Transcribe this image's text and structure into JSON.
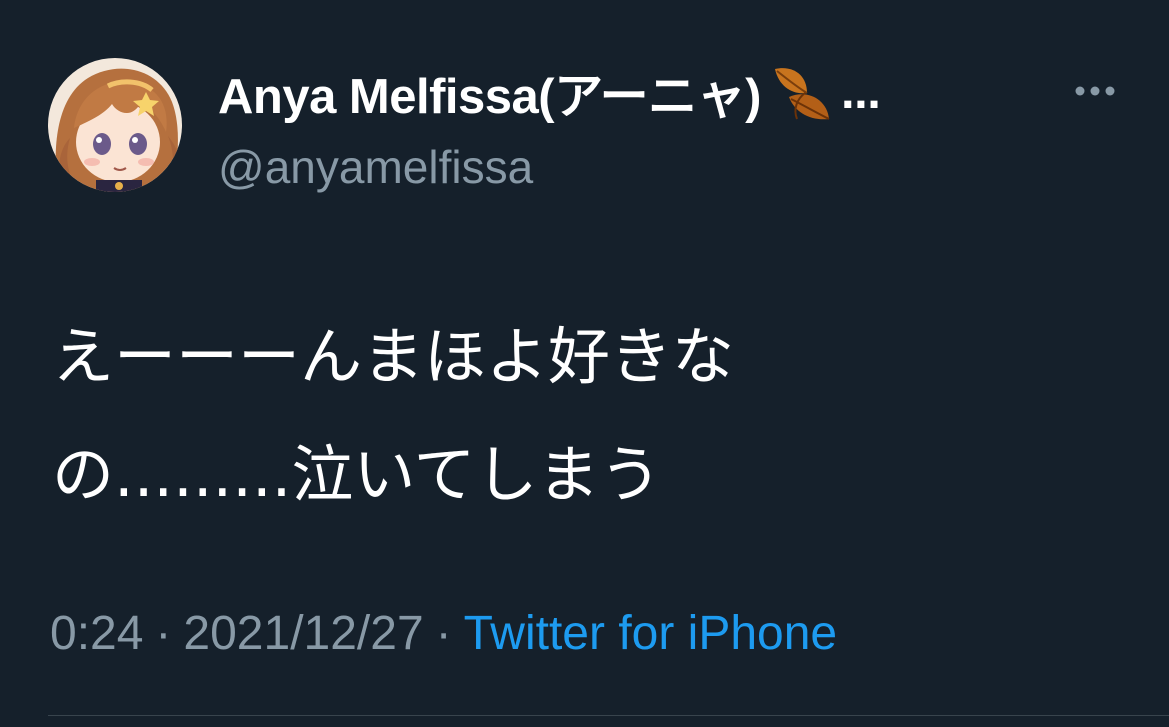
{
  "tweet": {
    "author": {
      "display_name": "Anya Melfissa(アーニャ)",
      "name_emoji_icon": "fallen-leaf-icon",
      "name_truncation": "...",
      "handle": "@anyamelfissa"
    },
    "more_icon": "more-horizontal-icon",
    "text_line_1": "えーーーんまほよ好きな",
    "text_line_2": "の.........泣いてしまう",
    "time": "0:24",
    "separator_1": "·",
    "date": "2021/12/27",
    "separator_2": "·",
    "source": "Twitter for iPhone"
  },
  "colors": {
    "background": "#15202b",
    "primary_text": "#ffffff",
    "secondary_text": "#8899a6",
    "link": "#1d9bf0",
    "divider": "#38444d"
  }
}
